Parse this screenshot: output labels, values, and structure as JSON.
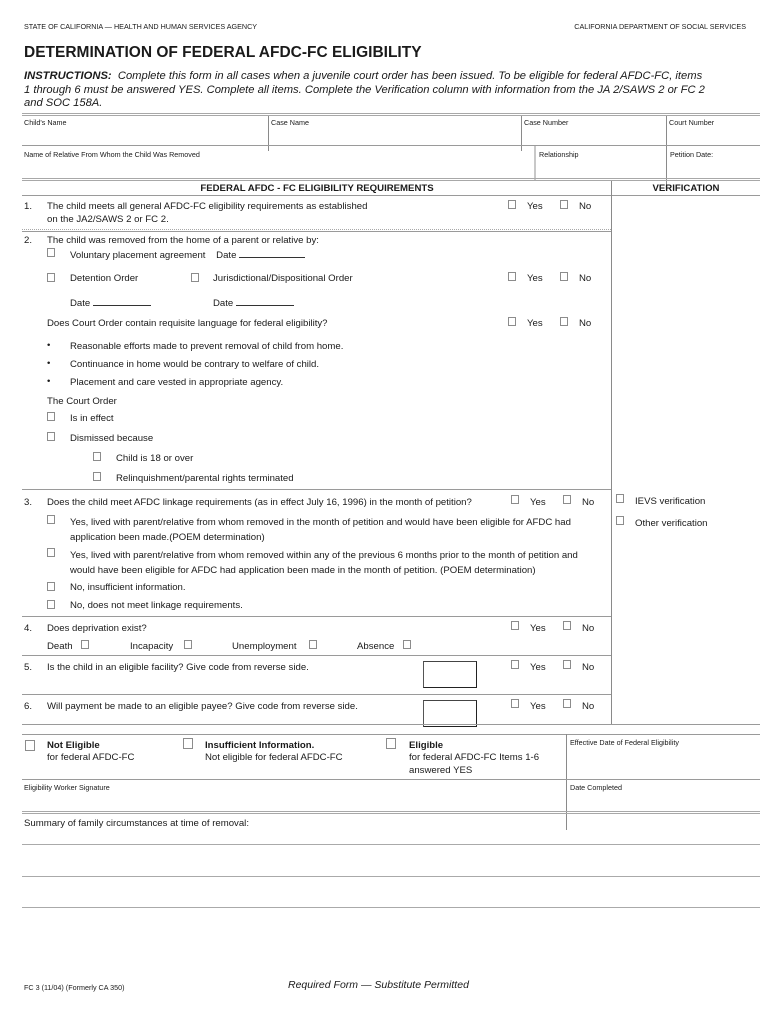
{
  "header": {
    "agency_left": "STATE OF CALIFORNIA — HEALTH AND HUMAN SERVICES AGENCY",
    "agency_right": "CALIFORNIA DEPARTMENT OF SOCIAL SERVICES",
    "title": "DETERMINATION OF FEDERAL AFDC-FC ELIGIBILITY",
    "instructions_label": "INSTRUCTIONS:",
    "instructions_line1": "Complete this form in all cases when a juvenile court order has been issued. To be eligible for federal AFDC-FC, items",
    "instructions_line2": "1 through 6 must be answered YES. Complete all items. Complete the Verification column with information from the JA 2/SAWS 2 or FC 2",
    "instructions_line3": "and SOC 158A."
  },
  "fields": {
    "childs_name": "Child's Name",
    "case_name": "Case Name",
    "case_number": "Case Number",
    "court_number": "Court Number",
    "relative_name": "Name of Relative From Whom the Child Was Removed",
    "relationship": "Relationship",
    "petition_date": "Petition Date:"
  },
  "section": {
    "requirements_header": "FEDERAL AFDC - FC ELIGIBILITY REQUIREMENTS",
    "verification_header": "VERIFICATION"
  },
  "yes_label": "Yes",
  "no_label": "No",
  "items": {
    "i1": {
      "num": "1.",
      "line1": "The child meets all general AFDC-FC eligibility requirements as established",
      "line2": "on the JA2/SAWS 2 or FC 2."
    },
    "i2": {
      "num": "2.",
      "text": "The child was removed from the home of a parent or relative by:",
      "voluntary": "Voluntary placement agreement",
      "date_label": "Date",
      "detention": "Detention Order",
      "jurisdictional": "Jurisdictional/Dispositional Order",
      "court_language": "Does Court Order contain requisite language for federal eligibility?",
      "bullets": [
        "Reasonable efforts made to prevent removal of child from home.",
        "Continuance in home would be contrary to welfare of child.",
        "Placement and care vested in appropriate agency."
      ],
      "court_order": "The Court Order",
      "in_effect": "Is in effect",
      "dismissed": "Dismissed because",
      "age18": "Child is 18 or over",
      "relinquish": "Relinquishment/parental rights terminated"
    },
    "i3": {
      "num": "3.",
      "text": "Does the child meet AFDC linkage requirements (as in effect July 16, 1996) in the month of petition?",
      "opt1_line1": "Yes, lived with parent/relative from whom removed in the month of petition and would have been eligible for AFDC had",
      "opt1_line2": "application been made.(POEM determination)",
      "opt2_line1": "Yes, lived with parent/relative from whom removed within any of the previous 6 months prior to the month of petition and",
      "opt2_line2": "would have been eligible for AFDC had application been made in the month of petition. (POEM determination)",
      "opt3": "No, insufficient information.",
      "opt4": "No, does not meet linkage requirements.",
      "ievs": "IEVS verification",
      "other": "Other verification"
    },
    "i4": {
      "num": "4.",
      "text": "Does deprivation exist?",
      "death": "Death",
      "incapacity": "Incapacity",
      "unemployment": "Unemployment",
      "absence": "Absence"
    },
    "i5": {
      "num": "5.",
      "text": "Is the child in an eligible facility? Give code from reverse side."
    },
    "i6": {
      "num": "6.",
      "text": "Will payment be made to an eligible payee? Give code from reverse side."
    }
  },
  "determination": {
    "not_eligible_title": "Not Eligible",
    "not_eligible_sub": "for federal AFDC-FC",
    "insufficient_title": "Insufficient Information.",
    "insufficient_sub": "Not eligible for federal AFDC-FC",
    "eligible_title": "Eligible",
    "eligible_sub1": "for federal AFDC-FC Items 1-6",
    "eligible_sub2": "answered YES",
    "effective_date": "Effective Date of Federal Eligibility",
    "worker_signature": "Eligibility Worker Signature",
    "date_completed": "Date Completed"
  },
  "summary_label": "Summary of family circumstances at time of removal:",
  "footer": {
    "form_id": "FC 3 (11/04) (Formerly CA 350)",
    "notice": "Required Form — Substitute Permitted"
  }
}
